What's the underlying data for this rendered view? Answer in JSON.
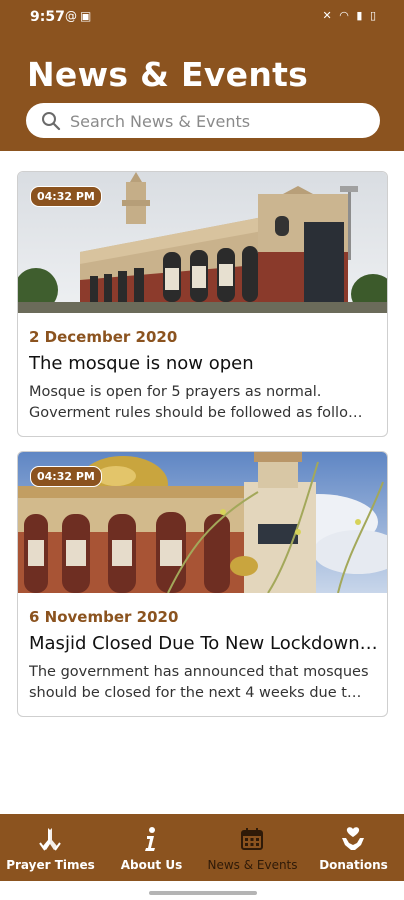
{
  "status_bar": {
    "time": "9:57",
    "left_icons": [
      "at-sign-icon",
      "image-icon"
    ],
    "right_icons": [
      "mute-icon",
      "wifi-icon",
      "signal-icon",
      "battery-icon"
    ]
  },
  "header": {
    "title": "News & Events",
    "search_placeholder": "Search News & Events",
    "background_color": "#8b531f"
  },
  "news": [
    {
      "time": "04:32 PM",
      "date": "2 December 2020",
      "title": "The mosque is now open",
      "desc_line1": "Mosque is open for 5 prayers as normal.",
      "desc_line2": "Goverment rules should be followed as follo…"
    },
    {
      "time": "04:32 PM",
      "date": "6 November 2020",
      "title": "Masjid Closed Due To New Lockdown…",
      "desc_line1": "The government has announced that mosques",
      "desc_line2": "should be closed for the next 4 weeks due t…"
    }
  ],
  "bottom_nav": {
    "items": [
      {
        "label": "Prayer Times",
        "icon": "praying-hands-icon",
        "active": true
      },
      {
        "label": "About Us",
        "icon": "info-icon",
        "active": true
      },
      {
        "label": "News & Events",
        "icon": "calendar-icon",
        "active": false
      },
      {
        "label": "Donations",
        "icon": "donation-icon",
        "active": true
      }
    ]
  }
}
